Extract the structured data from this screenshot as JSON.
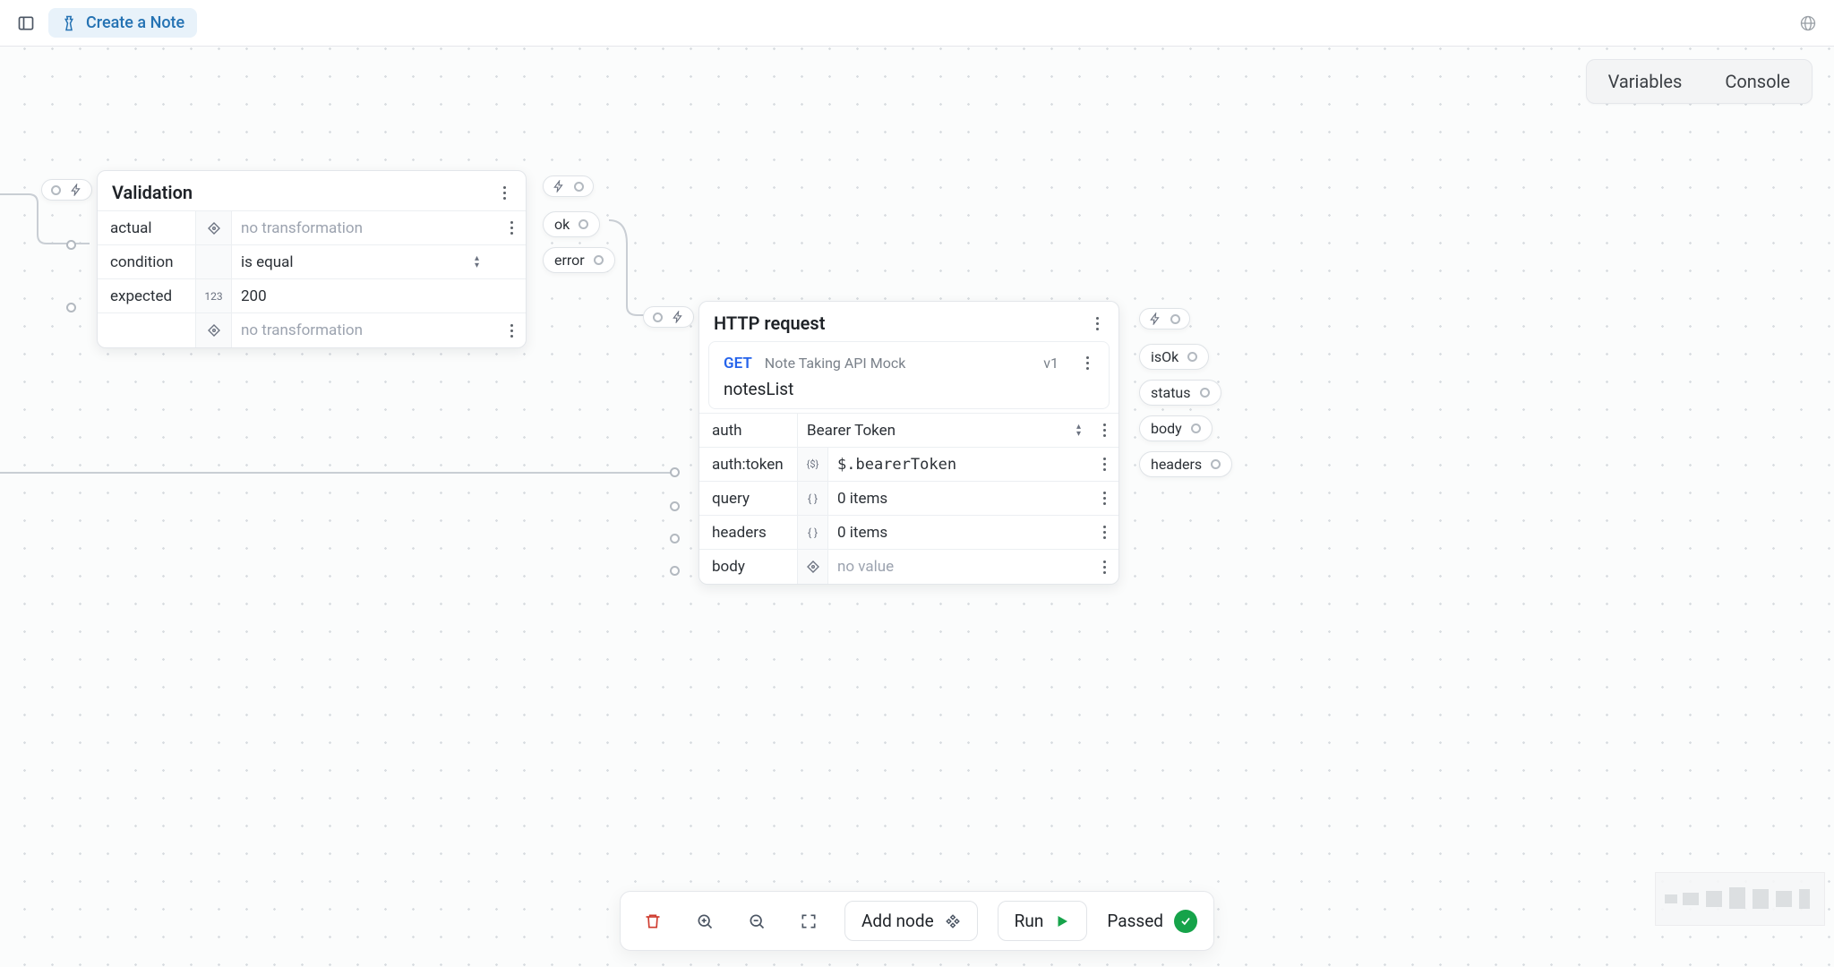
{
  "header": {
    "title": "Create a Note"
  },
  "right_tabs": {
    "variables": "Variables",
    "console": "Console"
  },
  "validation_node": {
    "title": "Validation",
    "rows": {
      "actual_label": "actual",
      "actual_value": "no transformation",
      "condition_label": "condition",
      "condition_value": "is equal",
      "expected_label": "expected",
      "expected_badge": "123",
      "expected_value": "200",
      "transform_value": "no transformation"
    }
  },
  "validation_outputs": {
    "ok": "ok",
    "error": "error"
  },
  "http_node": {
    "title": "HTTP request",
    "method": "GET",
    "api_name": "Note Taking API Mock",
    "version": "v1",
    "endpoint": "notesList",
    "rows": {
      "auth_label": "auth",
      "auth_value": "Bearer Token",
      "authtoken_label": "auth:token",
      "authtoken_value": "$.bearerToken",
      "query_label": "query",
      "query_badge": "{ }",
      "query_value": "0 items",
      "headers_label": "headers",
      "headers_badge": "{ }",
      "headers_value": "0 items",
      "body_label": "body",
      "body_value": "no value"
    }
  },
  "http_outputs": {
    "isok": "isOk",
    "status": "status",
    "body": "body",
    "headers": "headers"
  },
  "bottom": {
    "add_node": "Add node",
    "run": "Run",
    "status": "Passed"
  }
}
